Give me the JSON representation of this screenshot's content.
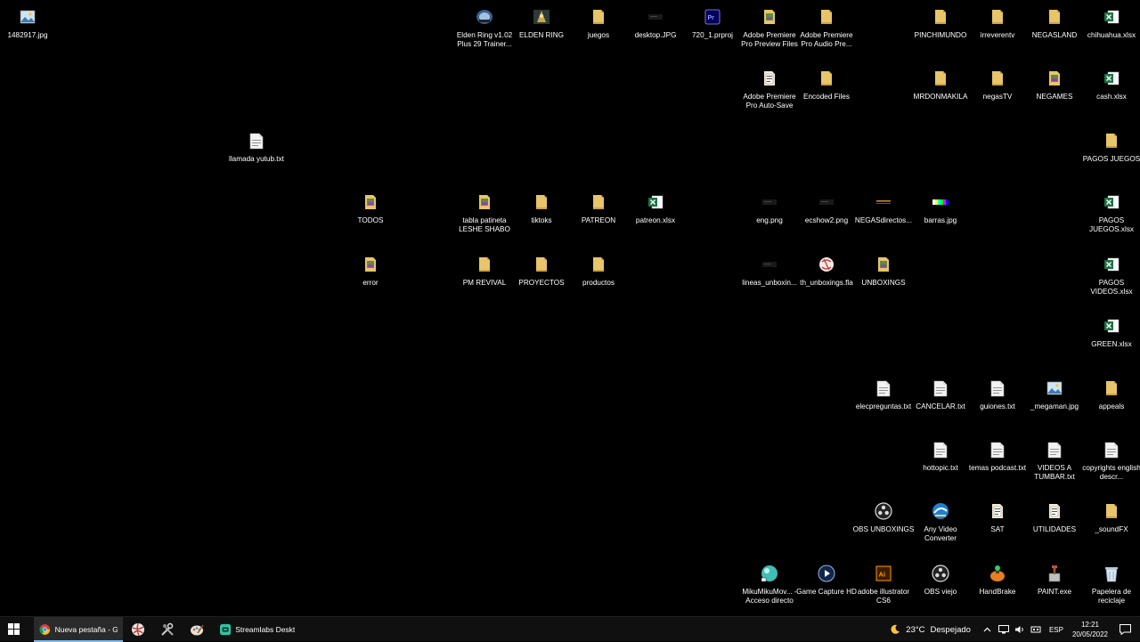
{
  "theme": {
    "folder": "#e8c56b",
    "folder_dark": "#c9a24a",
    "excel": "#1e7145",
    "doc": "#f2f2f2",
    "taskbar_bg": "#101010",
    "accent": "#7fb7e6"
  },
  "desktop_icons": [
    {
      "label": "1482917.jpg",
      "kind": "image"
    },
    {
      "label": "llamada yutub.txt",
      "kind": "text"
    },
    {
      "label": "TODOS",
      "kind": "folder-img"
    },
    {
      "label": "error",
      "kind": "folder-img"
    },
    {
      "label": "Elden Ring v1.02 Plus 29 Trainer...",
      "kind": "app"
    },
    {
      "label": "ELDEN RING",
      "kind": "game"
    },
    {
      "label": "juegos",
      "kind": "folder"
    },
    {
      "label": "desktop.JPG",
      "kind": "image-dark"
    },
    {
      "label": "720_1.prproj",
      "kind": "premiere"
    },
    {
      "label": "Adobe Premiere Pro Preview Files",
      "kind": "folder-img"
    },
    {
      "label": "Adobe Premiere Pro Audio Pre...",
      "kind": "folder"
    },
    {
      "label": "Adobe Premiere Pro Auto-Save",
      "kind": "folder-doc"
    },
    {
      "label": "Encoded Files",
      "kind": "folder"
    },
    {
      "label": "tabla patineta LESHE SHABO",
      "kind": "folder-img"
    },
    {
      "label": "tiktoks",
      "kind": "folder"
    },
    {
      "label": "PATREON",
      "kind": "folder"
    },
    {
      "label": "patreon.xlsx",
      "kind": "excel"
    },
    {
      "label": "PM REVIVAL",
      "kind": "folder"
    },
    {
      "label": "PROYECTOS",
      "kind": "folder"
    },
    {
      "label": "productos",
      "kind": "folder"
    },
    {
      "label": "eng.png",
      "kind": "image-dark"
    },
    {
      "label": "ecshow2.png",
      "kind": "image-dark"
    },
    {
      "label": "NEGASdirectos...",
      "kind": "image-strip"
    },
    {
      "label": "barras.jpg",
      "kind": "image-bars"
    },
    {
      "label": "lineas_unboxin...",
      "kind": "image-dark"
    },
    {
      "label": "th_unboxings.fla",
      "kind": "flash"
    },
    {
      "label": "UNBOXINGS",
      "kind": "folder-img"
    },
    {
      "label": "PINCHIMUNDO",
      "kind": "folder"
    },
    {
      "label": "irreverentv",
      "kind": "folder"
    },
    {
      "label": "NEGASLAND",
      "kind": "folder"
    },
    {
      "label": "chihuahua.xlsx",
      "kind": "excel"
    },
    {
      "label": "MRDONMAKILA",
      "kind": "folder"
    },
    {
      "label": "negasTV",
      "kind": "folder"
    },
    {
      "label": "NEGAMES",
      "kind": "folder-img"
    },
    {
      "label": "cash.xlsx",
      "kind": "excel"
    },
    {
      "label": "PAGOS JUEGOS",
      "kind": "folder"
    },
    {
      "label": "PAGOS JUEGOS.xlsx",
      "kind": "excel"
    },
    {
      "label": "PAGOS VIDEOS.xlsx",
      "kind": "excel"
    },
    {
      "label": "GREEN.xlsx",
      "kind": "excel"
    },
    {
      "label": "elecpreguntas.txt",
      "kind": "text"
    },
    {
      "label": "CANCELAR.txt",
      "kind": "text"
    },
    {
      "label": "guiones.txt",
      "kind": "text"
    },
    {
      "label": "_megaman.jpg",
      "kind": "image"
    },
    {
      "label": "appeals",
      "kind": "folder"
    },
    {
      "label": "hottopic.txt",
      "kind": "text"
    },
    {
      "label": "temas podcast.txt",
      "kind": "text"
    },
    {
      "label": "VIDEOS A TUMBAR.txt",
      "kind": "text"
    },
    {
      "label": "copyrights english descr...",
      "kind": "text"
    },
    {
      "label": "OBS UNBOXINGS",
      "kind": "obs"
    },
    {
      "label": "Any Video Converter",
      "kind": "converter"
    },
    {
      "label": "SAT",
      "kind": "folder-doc"
    },
    {
      "label": "UTILIDADES",
      "kind": "folder-doc"
    },
    {
      "label": "_soundFX",
      "kind": "folder"
    },
    {
      "label": "MikuMikuMov... - Acceso directo",
      "kind": "sphere"
    },
    {
      "label": "Game Capture HD",
      "kind": "capture"
    },
    {
      "label": "adobe illustrator CS6",
      "kind": "illustrator"
    },
    {
      "label": "OBS viejo",
      "kind": "obs"
    },
    {
      "label": "HandBrake",
      "kind": "handbrake"
    },
    {
      "label": "PAINT.exe",
      "kind": "paint"
    },
    {
      "label": "Papelera de reciclaje",
      "kind": "recycle"
    }
  ],
  "taskbar": {
    "apps": [
      {
        "title": "Nueva pestaña - G...",
        "icon": "chrome-icon",
        "active": true
      },
      {
        "title": "",
        "icon": "ball-icon",
        "active": false
      },
      {
        "title": "",
        "icon": "tools-icon",
        "active": false
      },
      {
        "title": "",
        "icon": "paint-icon",
        "active": false
      },
      {
        "title": "Streamlabs Desktop",
        "icon": "streamlabs-icon",
        "active": false
      }
    ],
    "weather": {
      "temp": "23°C",
      "condition": "Despejado"
    },
    "language": "ESP",
    "time": "12:21",
    "date": "20/05/2022"
  }
}
